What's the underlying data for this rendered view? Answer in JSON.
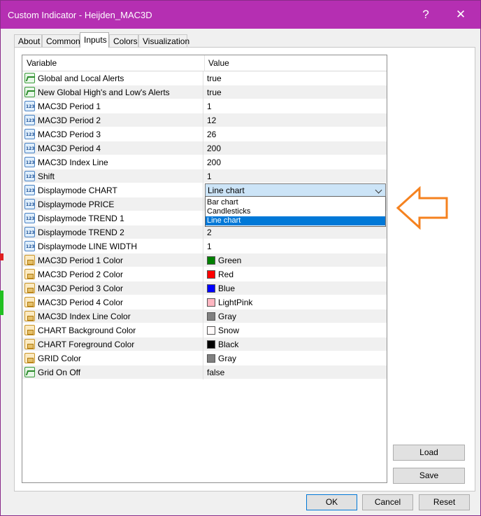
{
  "window": {
    "title": "Custom Indicator - Heijden_MAC3D",
    "help_symbol": "?",
    "close_symbol": "✕"
  },
  "tabs": [
    "About",
    "Common",
    "Inputs",
    "Colors",
    "Visualization"
  ],
  "active_tab": "Inputs",
  "table": {
    "headers": {
      "variable": "Variable",
      "value": "Value"
    },
    "rows": [
      {
        "icon": "bool-icon",
        "variable": "Global and Local Alerts",
        "value": "true"
      },
      {
        "icon": "bool-icon",
        "variable": "New Global High's and Low's Alerts",
        "value": "true"
      },
      {
        "icon": "number-icon",
        "variable": "MAC3D Period 1",
        "value": "1"
      },
      {
        "icon": "number-icon",
        "variable": "MAC3D Period 2",
        "value": "12"
      },
      {
        "icon": "number-icon",
        "variable": "MAC3D Period 3",
        "value": "26"
      },
      {
        "icon": "number-icon",
        "variable": "MAC3D Period 4",
        "value": "200"
      },
      {
        "icon": "number-icon",
        "variable": "MAC3D Index Line",
        "value": "200"
      },
      {
        "icon": "number-icon",
        "variable": "Shift",
        "value": "1"
      },
      {
        "icon": "number-icon",
        "variable": "Displaymode CHART",
        "value": "Line chart"
      },
      {
        "icon": "number-icon",
        "variable": "Displaymode PRICE",
        "value": ""
      },
      {
        "icon": "number-icon",
        "variable": "Displaymode TREND 1",
        "value": ""
      },
      {
        "icon": "number-icon",
        "variable": "Displaymode TREND 2",
        "value": "2"
      },
      {
        "icon": "number-icon",
        "variable": "Displaymode LINE WIDTH",
        "value": "1"
      },
      {
        "icon": "color-icon",
        "variable": "MAC3D Period 1 Color",
        "value": "Green",
        "swatch": "#008000"
      },
      {
        "icon": "color-icon",
        "variable": "MAC3D Period 2 Color",
        "value": "Red",
        "swatch": "#ff0000"
      },
      {
        "icon": "color-icon",
        "variable": "MAC3D Period 3 Color",
        "value": "Blue",
        "swatch": "#0000ff"
      },
      {
        "icon": "color-icon",
        "variable": "MAC3D Period 4 Color",
        "value": "LightPink",
        "swatch": "#ffb6c1"
      },
      {
        "icon": "color-icon",
        "variable": "MAC3D Index Line Color",
        "value": "Gray",
        "swatch": "#808080"
      },
      {
        "icon": "color-icon",
        "variable": "CHART Background Color",
        "value": "Snow",
        "swatch": "#fffafa"
      },
      {
        "icon": "color-icon",
        "variable": "CHART Foreground Color",
        "value": "Black",
        "swatch": "#000000"
      },
      {
        "icon": "color-icon",
        "variable": "GRID Color",
        "value": "Gray",
        "swatch": "#808080"
      },
      {
        "icon": "bool-icon",
        "variable": "Grid On Off",
        "value": "false"
      }
    ]
  },
  "dropdown": {
    "selected": "Line chart",
    "options": [
      "Bar chart",
      "Candlesticks",
      "Line chart"
    ]
  },
  "buttons": {
    "load": "Load",
    "save": "Save",
    "ok": "OK",
    "cancel": "Cancel",
    "reset": "Reset"
  },
  "colors": {
    "titlebar": "#b52fb2",
    "selection": "#0078d7",
    "arrow": "#f5821f"
  }
}
